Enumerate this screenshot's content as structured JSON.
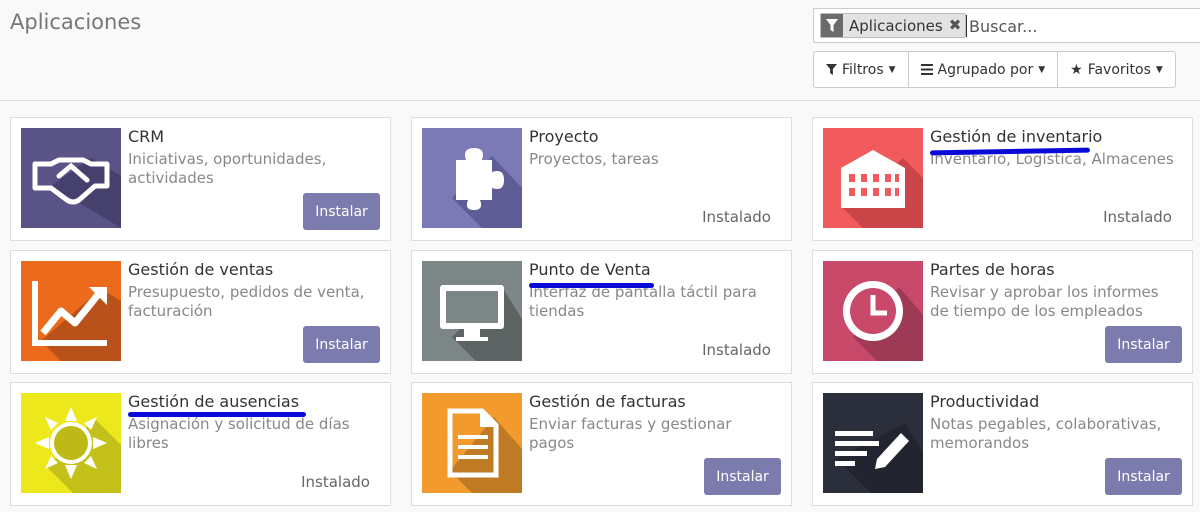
{
  "header": {
    "title": "Aplicaciones",
    "search": {
      "facet_label": "Aplicaciones",
      "facet_icon": "filter-icon",
      "placeholder": "Buscar...",
      "value": ""
    },
    "filters": [
      {
        "label": "Filtros",
        "icon": "filter-icon"
      },
      {
        "label": "Agrupado por",
        "icon": "list-icon"
      },
      {
        "label": "Favoritos",
        "icon": "star-icon"
      }
    ]
  },
  "colors": {
    "install_button": "#7c7bad",
    "annotation_underline": "#0a0ad8"
  },
  "apps": [
    {
      "name": "CRM",
      "summary": "Iniciativas, oportunidades, actividades",
      "state": "Instalar",
      "installed": false,
      "icon": "handshake-icon",
      "color": "#5a5486"
    },
    {
      "name": "Proyecto",
      "summary": "Proyectos, tareas",
      "state": "Instalado",
      "installed": true,
      "icon": "puzzle-icon",
      "color": "#7b79b6"
    },
    {
      "name": "Gestión de inventario",
      "summary": "Inventario, Logística, Almacenes",
      "state": "Instalado",
      "installed": true,
      "icon": "warehouse-icon",
      "color": "#f15b5d"
    },
    {
      "name": "Gestión de ventas",
      "summary": "Presupuesto, pedidos de venta, facturación",
      "state": "Instalar",
      "installed": false,
      "icon": "trending-up-icon",
      "color": "#eb6a1b"
    },
    {
      "name": "Punto de Venta",
      "summary": "Interfaz de pantalla táctil para tiendas",
      "state": "Instalado",
      "installed": true,
      "icon": "monitor-icon",
      "color": "#7c8686"
    },
    {
      "name": "Partes de horas",
      "summary": "Revisar y aprobar los informes de tiempo de los empleados",
      "state": "Instalar",
      "installed": false,
      "icon": "clock-icon",
      "color": "#c9496b"
    },
    {
      "name": "Gestión de ausencias",
      "summary": "Asignación y solicitud de días libres",
      "state": "Instalado",
      "installed": true,
      "icon": "sun-icon",
      "color": "#ede81c"
    },
    {
      "name": "Gestión de facturas",
      "summary": "Enviar facturas y gestionar pagos",
      "state": "Instalar",
      "installed": false,
      "icon": "document-icon",
      "color": "#f29a2e"
    },
    {
      "name": "Productividad",
      "summary": "Notas pegables, colaborativas, memorandos",
      "state": "Instalar",
      "installed": false,
      "icon": "notes-pencil-icon",
      "color": "#2b2f3b"
    }
  ]
}
